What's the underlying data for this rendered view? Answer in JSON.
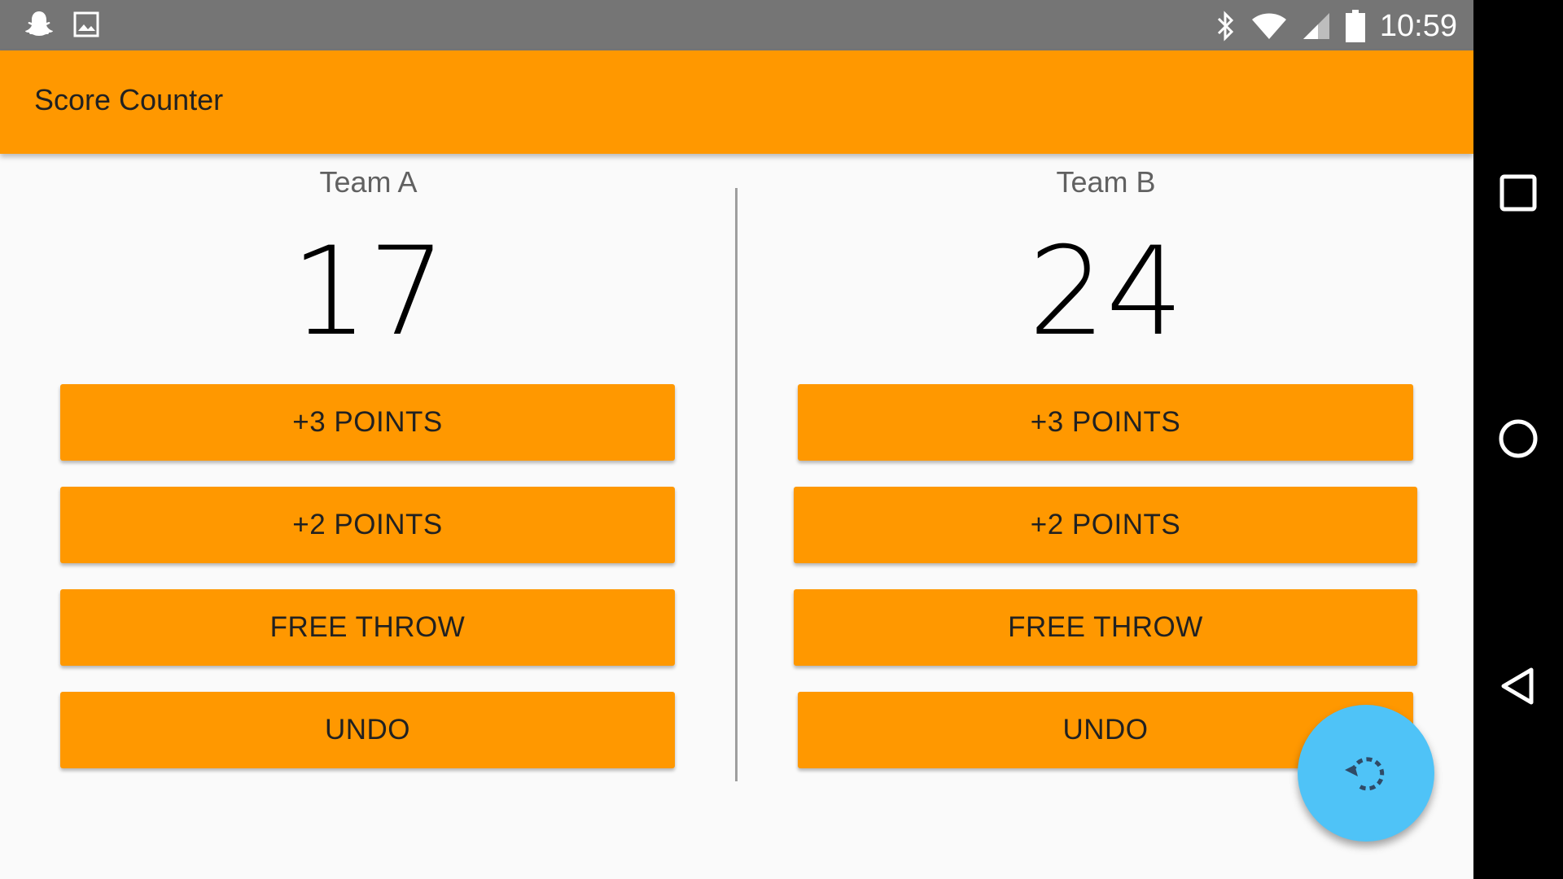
{
  "status_bar": {
    "time": "10:59",
    "icons_left": [
      "snapchat-ghost-icon",
      "image-icon"
    ],
    "icons_right": [
      "bluetooth-icon",
      "wifi-icon",
      "cellular-signal-icon",
      "battery-icon"
    ]
  },
  "app_bar": {
    "title": "Score Counter"
  },
  "team_a": {
    "name": "Team A",
    "score": "17",
    "buttons": {
      "three": "+3 POINTS",
      "two": "+2 POINTS",
      "free": "FREE THROW",
      "undo": "UNDO"
    }
  },
  "team_b": {
    "name": "Team B",
    "score": "24",
    "buttons": {
      "three": "+3 POINTS",
      "two": "+2 POINTS",
      "free": "FREE THROW",
      "undo": "UNDO"
    }
  },
  "fab": {
    "icon": "reset-icon"
  },
  "nav_bar": {
    "icons": [
      "recents-square-icon",
      "home-circle-icon",
      "back-triangle-icon"
    ]
  },
  "colors": {
    "accent": "#ff9800",
    "fab": "#4fc3f7",
    "status_bar": "#757575",
    "nav_bar": "#000000"
  }
}
